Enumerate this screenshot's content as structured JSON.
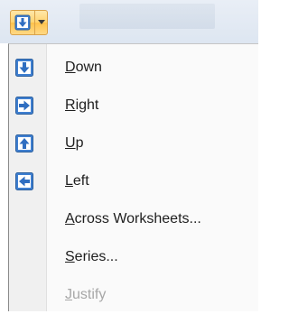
{
  "fill_button": {
    "icon": "fill-down-icon",
    "accent": "#ffc24b"
  },
  "menu": {
    "items": [
      {
        "accel": "D",
        "rest": "own",
        "icon": "fill-down-icon",
        "enabled": true
      },
      {
        "accel": "R",
        "rest": "ight",
        "icon": "fill-right-icon",
        "enabled": true
      },
      {
        "accel": "U",
        "rest": "p",
        "icon": "fill-up-icon",
        "enabled": true
      },
      {
        "accel": "L",
        "rest": "eft",
        "icon": "fill-left-icon",
        "enabled": true
      },
      {
        "accel": "A",
        "rest": "cross Worksheets...",
        "icon": null,
        "enabled": true
      },
      {
        "pre": "",
        "accel": "S",
        "rest": "eries...",
        "icon": null,
        "enabled": true
      },
      {
        "accel": "J",
        "rest": "ustify",
        "icon": null,
        "enabled": false
      }
    ]
  },
  "colors": {
    "icon_blue": "#3f7fd0",
    "disabled_text": "#a7a7a7"
  }
}
